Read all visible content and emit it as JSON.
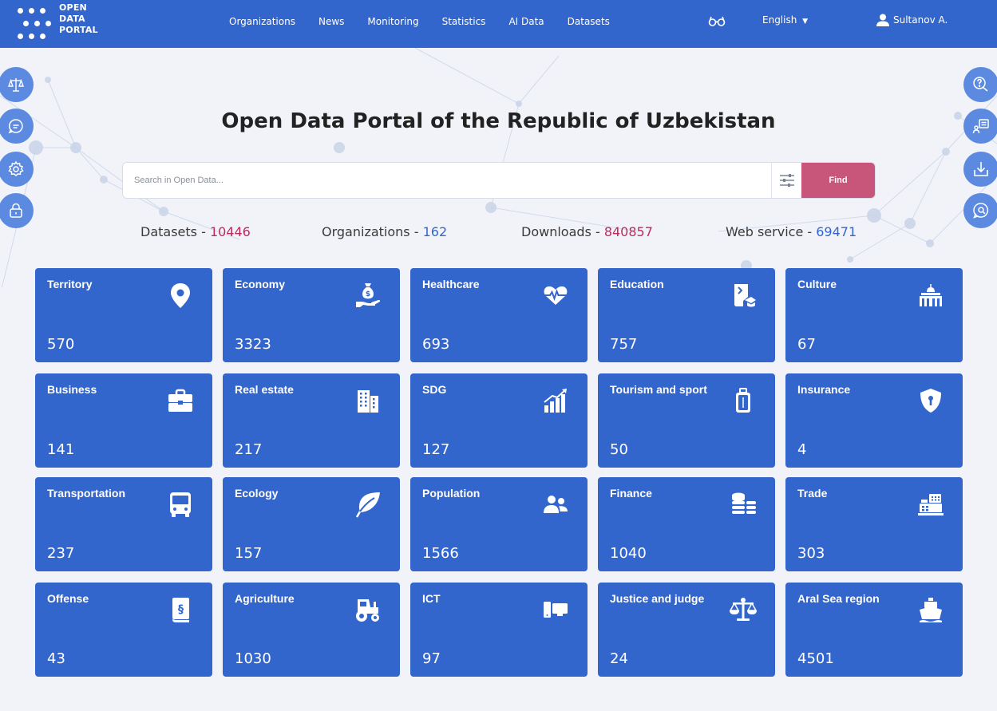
{
  "header": {
    "logo_line1": "OPEN",
    "logo_line2": "DATA",
    "logo_line3": "PORTAL",
    "nav": [
      "Organizations",
      "News",
      "Monitoring",
      "Statistics",
      "AI Data",
      "Datasets"
    ],
    "language": "English",
    "user": "Sultanov A.",
    "accessibility_icon": "glasses-icon"
  },
  "page_title": "Open Data Portal of the Republic of Uzbekistan",
  "search": {
    "placeholder": "Search in Open Data...",
    "find_label": "Find"
  },
  "stats": {
    "datasets_label": "Datasets - ",
    "datasets_value": "10446",
    "organizations_label": "Organizations - ",
    "organizations_value": "162",
    "downloads_label": "Downloads - ",
    "downloads_value": "840857",
    "webservice_label": "Web service - ",
    "webservice_value": "69471"
  },
  "left_side_buttons": [
    "scales-icon",
    "chat-icon",
    "gear-icon",
    "lock-icon"
  ],
  "right_side_buttons": [
    "question-chat-icon",
    "api-doc-icon",
    "download-icon",
    "feedback-icon"
  ],
  "categories": [
    {
      "name": "Territory",
      "count": "570",
      "icon": "map-pin-icon"
    },
    {
      "name": "Economy",
      "count": "3323",
      "icon": "money-hand-icon"
    },
    {
      "name": "Healthcare",
      "count": "693",
      "icon": "heartbeat-icon"
    },
    {
      "name": "Education",
      "count": "757",
      "icon": "education-book-icon"
    },
    {
      "name": "Culture",
      "count": "67",
      "icon": "theatre-icon"
    },
    {
      "name": "Business",
      "count": "141",
      "icon": "briefcase-icon"
    },
    {
      "name": "Real estate",
      "count": "217",
      "icon": "building-icon"
    },
    {
      "name": "SDG",
      "count": "127",
      "icon": "growth-chart-icon"
    },
    {
      "name": "Tourism and sport",
      "count": "50",
      "icon": "luggage-icon"
    },
    {
      "name": "Insurance",
      "count": "4",
      "icon": "shield-lock-icon"
    },
    {
      "name": "Transportation",
      "count": "237",
      "icon": "bus-icon"
    },
    {
      "name": "Ecology",
      "count": "157",
      "icon": "leaf-icon"
    },
    {
      "name": "Population",
      "count": "1566",
      "icon": "people-icon"
    },
    {
      "name": "Finance",
      "count": "1040",
      "icon": "coins-icon"
    },
    {
      "name": "Trade",
      "count": "303",
      "icon": "cash-register-icon"
    },
    {
      "name": "Offense",
      "count": "43",
      "icon": "law-book-icon"
    },
    {
      "name": "Agriculture",
      "count": "1030",
      "icon": "tractor-icon"
    },
    {
      "name": "ICT",
      "count": "97",
      "icon": "devices-icon"
    },
    {
      "name": "Justice and judge",
      "count": "24",
      "icon": "balance-scale-icon"
    },
    {
      "name": "Aral Sea region",
      "count": "4501",
      "icon": "ship-icon"
    }
  ],
  "colors": {
    "primary": "#3366cc",
    "accent": "#c8557a",
    "stat_red": "#c0285a",
    "background": "#f1f3f8"
  }
}
